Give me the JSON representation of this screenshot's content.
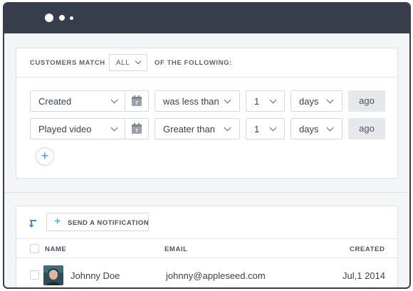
{
  "window": {
    "controls": [
      "dot-large",
      "dot-medium",
      "dot-small"
    ]
  },
  "filter": {
    "customers_match_label": "CUSTOMERS MATCH",
    "match_value": "ALL",
    "of_following_label": "OF THE FOLLOWING:",
    "rows": [
      {
        "field": "Created",
        "operator": "was less than",
        "amount": "1",
        "unit": "days",
        "suffix": "ago"
      },
      {
        "field": "Played video",
        "operator": "Greater than",
        "amount": "1",
        "unit": "days",
        "suffix": "ago"
      }
    ],
    "add_condition_label": "+"
  },
  "list": {
    "send_notification_label": "SEND A NOTIFICATION",
    "plus_label": "+",
    "columns": {
      "name": "NAME",
      "email": "EMAIL",
      "created": "CREATED"
    },
    "rows": [
      {
        "name": "Johnny Doe",
        "email": "johnny@appleseed.com",
        "created": "Jul,1 2014"
      }
    ]
  },
  "colors": {
    "titlebar": "#373d4b",
    "accent": "#3d8fd6",
    "ago_bg": "#e6e8ec"
  },
  "icons": [
    "calendar-icon",
    "chevron-down-icon",
    "plus-icon",
    "sort-arrow-icon"
  ]
}
